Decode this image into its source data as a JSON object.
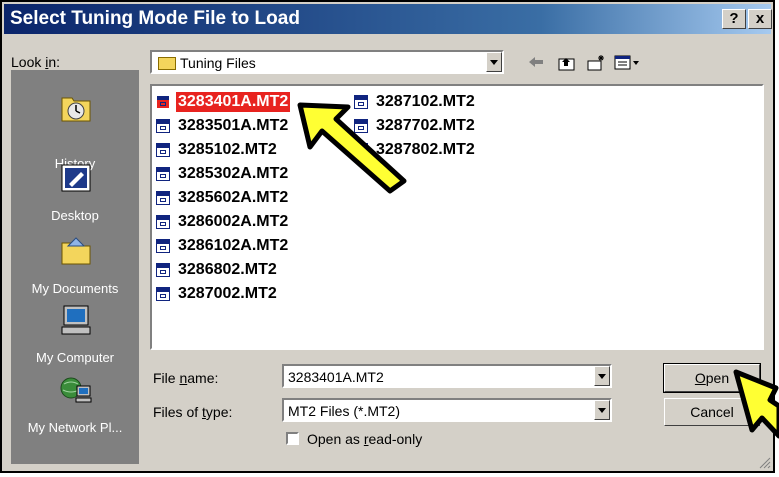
{
  "dialog": {
    "title": "Select Tuning Mode File to Load",
    "help_button": "?",
    "close_button": "x"
  },
  "lookin": {
    "label_pre": "Look ",
    "label_u": "i",
    "label_post": "n:",
    "value": "Tuning Files"
  },
  "toolbar": {
    "back_icon": "back-arrow-icon",
    "up_icon": "up-folder-icon",
    "newfolder_icon": "new-folder-icon",
    "views_icon": "views-menu-icon"
  },
  "places": [
    {
      "label": "History",
      "icon": "history-icon"
    },
    {
      "label": "Desktop",
      "icon": "desktop-icon"
    },
    {
      "label": "My Documents",
      "icon": "my-documents-icon"
    },
    {
      "label": "My Computer",
      "icon": "my-computer-icon"
    },
    {
      "label": "My Network Pl...",
      "icon": "my-network-icon"
    }
  ],
  "files": [
    {
      "name": "3283401A.MT2",
      "selected": true
    },
    {
      "name": "3283501A.MT2"
    },
    {
      "name": "3285102.MT2"
    },
    {
      "name": "3285302A.MT2"
    },
    {
      "name": "3285602A.MT2"
    },
    {
      "name": "3286002A.MT2"
    },
    {
      "name": "3286102A.MT2"
    },
    {
      "name": "3286802.MT2"
    },
    {
      "name": "3287002.MT2"
    },
    {
      "name": "3287102.MT2"
    },
    {
      "name": "3287702.MT2"
    },
    {
      "name": "3287802.MT2"
    }
  ],
  "filename": {
    "label_pre": "File ",
    "label_u": "n",
    "label_post": "ame:",
    "value": "3283401A.MT2"
  },
  "filetype": {
    "label_pre": "Files of ",
    "label_u": "t",
    "label_post": "ype:",
    "value": "MT2 Files (*.MT2)"
  },
  "readonly": {
    "label_pre": "Open as ",
    "label_u": "r",
    "label_post": "ead-only",
    "checked": false
  },
  "buttons": {
    "open_u": "O",
    "open_rest": "pen",
    "cancel": "Cancel"
  },
  "annotations": {
    "arrow_color": "#ffff33"
  }
}
